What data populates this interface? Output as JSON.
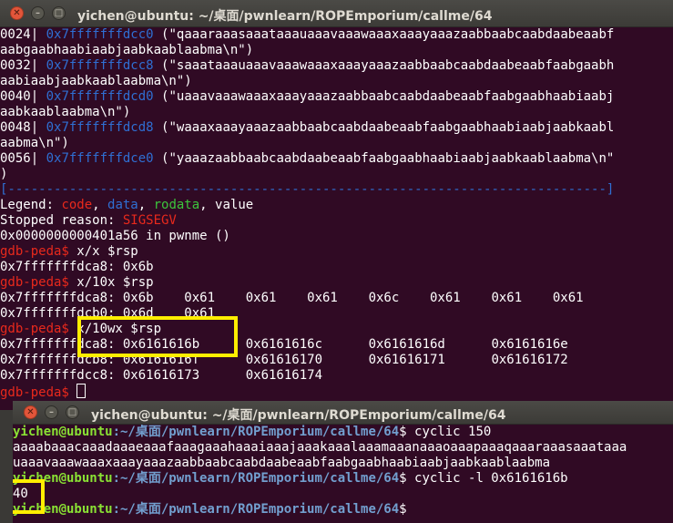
{
  "window1": {
    "title": "yichen@ubuntu: ~/桌面/pwnlearn/ROPEmporium/callme/64",
    "stack_lines": [
      {
        "idx": "0024|",
        "addr": "0x7fffffffdcc0",
        "val": "(\"qaaaraaasaaataaauaaavaaawaaaxaaayaaazaabbaabcaabdaabeaabf",
        "cont": "aabgaabhaabiaabjaabkaablaabma\\n\")"
      },
      {
        "idx": "0032|",
        "addr": "0x7fffffffdcc8",
        "val": "(\"saaataaauaaavaaawaaaxaaayaaazaabbaabcaabdaabeaabfaabgaabh",
        "cont": "aabiaabjaabkaablaabma\\n\")"
      },
      {
        "idx": "0040|",
        "addr": "0x7fffffffdcd0",
        "val": "(\"uaaavaaawaaaxaaayaaazaabbaabcaabdaabeaabfaabgaabhaabiaabj",
        "cont": "aabkaablaabma\\n\")"
      },
      {
        "idx": "0048|",
        "addr": "0x7fffffffdcd8",
        "val": "(\"waaaxaaayaaazaabbaabcaabdaabeaabfaabgaabhaabiaabjaabkaabl",
        "cont": "aabma\\n\")"
      },
      {
        "idx": "0056|",
        "addr": "0x7fffffffdce0",
        "val": "(\"yaaazaabbaabcaabdaabeaabfaabgaabhaabiaabjaabkaablaabma\\n\"",
        "cont": ")"
      }
    ],
    "separator": "[------------------------------------------------------------------------------]",
    "legend_label": "Legend: ",
    "legend_code": "code",
    "legend_data": "data",
    "legend_rodata": "rodata",
    "legend_value": "value",
    "legend_sep": ", ",
    "stopped_label": "Stopped reason: ",
    "stopped_value": "SIGSEGV",
    "location": "0x0000000000401a56 in pwnme ()",
    "prompt": "gdb-peda$",
    "cmd1": " x/x $rsp",
    "out1": "0x7fffffffdca8: 0x6b",
    "cmd2": " x/10x $rsp",
    "out2a": "0x7fffffffdca8: 0x6b    0x61    0x61    0x61    0x6c    0x61    0x61    0x61",
    "out2b": "0x7fffffffdcb0: 0x6d    0x61",
    "cmd3": " x/10wx $rsp",
    "out3a": "0x7fffffffdca8: 0x6161616b      0x6161616c      0x6161616d      0x6161616e",
    "out3b": "0x7fffffffdcb8: 0x6161616f      0x61616170      0x61616171      0x61616172",
    "out3c": "0x7fffffffdcc8: 0x61616173      0x61616174",
    "highlight_color": "#ffee00"
  },
  "window2": {
    "title": "yichen@ubuntu: ~/桌面/pwnlearn/ROPEmporium/callme/64",
    "user_host": "yichen@ubuntu",
    "path": ":~/桌面/pwnlearn/ROPEmporium/callme/64",
    "dollar": "$",
    "cmd1": " cyclic 150",
    "out1a": "aaaabaaacaaadaaaeaaafaaagaaahaaaiaaajaaakaaalaaamaaanaaaoaaapaaaqaaaraaasaaataaa",
    "out1b": "uaaavaaawaaaxaaayaaazaabbaabcaabdaabeaabfaabgaabhaabiaabjaabkaablaabma",
    "cmd2": " cyclic -l 0x6161616b",
    "out2": "40"
  }
}
